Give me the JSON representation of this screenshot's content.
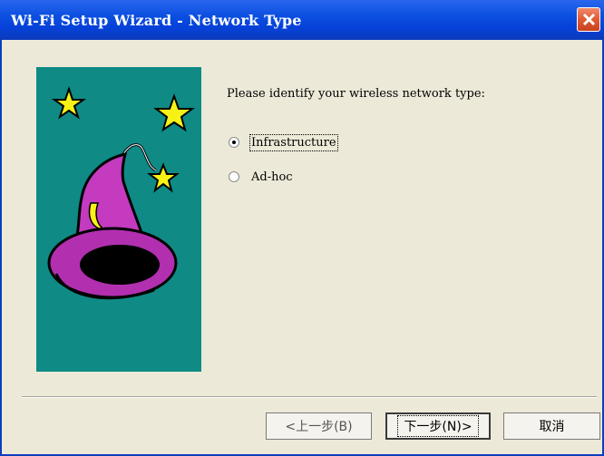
{
  "window": {
    "title": "Wi-Fi Setup Wizard - Network Type"
  },
  "content": {
    "prompt": "Please identify your wireless network type:",
    "options": [
      {
        "label": "Infrastructure",
        "selected": true
      },
      {
        "label": "Ad-hoc",
        "selected": false
      }
    ]
  },
  "buttons": {
    "back_label": "<上一步(B)",
    "next_label": "下一步(N)>",
    "cancel_label": "取消"
  },
  "icons": {
    "close": "close-icon",
    "wizard_art": "wizard-hat-stars-illustration"
  },
  "colors": {
    "titlebar": "#0b4fe0",
    "close_button": "#e05a32",
    "art_background": "#0f8a85",
    "hat": "#c43bbf",
    "star": "#f7f215",
    "dialog_background": "#ece9d8"
  }
}
